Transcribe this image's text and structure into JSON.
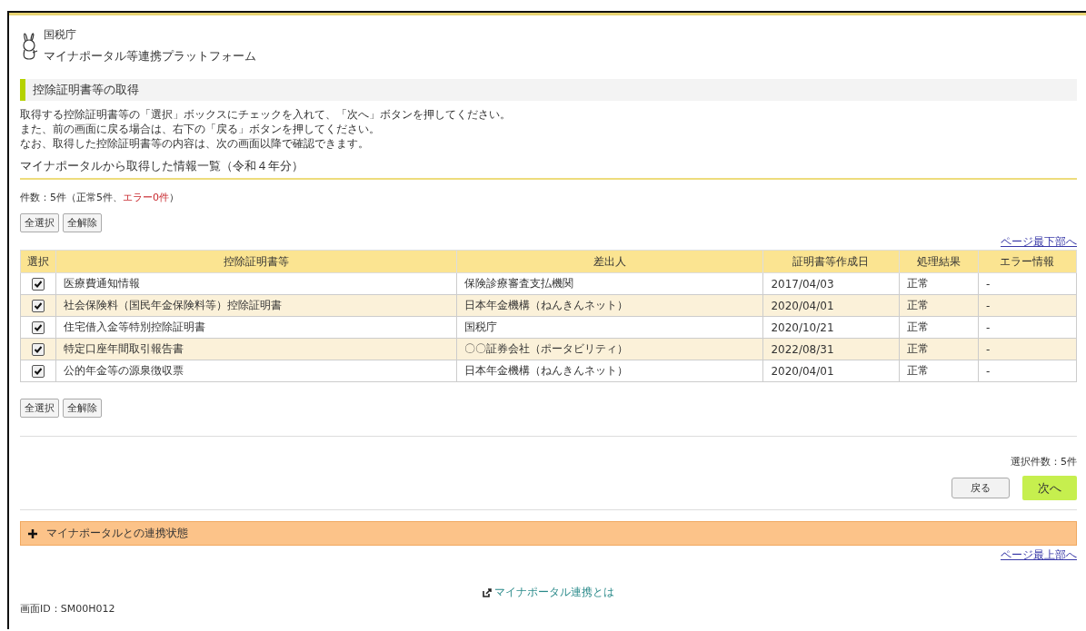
{
  "header": {
    "agency": "国税庁",
    "platform": "マイナポータル等連携プラットフォーム"
  },
  "page_title": "控除証明書等の取得",
  "instructions": [
    "取得する控除証明書等の「選択」ボックスにチェックを入れて、「次へ」ボタンを押してください。",
    "また、前の画面に戻る場合は、右下の「戻る」ボタンを押してください。",
    "なお、取得した控除証明書等の内容は、次の画面以降で確認できます。"
  ],
  "section_title": "マイナポータルから取得した情報一覧（令和４年分）",
  "count": {
    "text": "件数：5件（正常5件、",
    "error": "エラー0件",
    "close": "）"
  },
  "bulk_buttons_top": [
    "全選択",
    "全解除"
  ],
  "to_bottom_link": "ページ最下部へ",
  "table": {
    "columns": [
      "選択",
      "控除証明書等",
      "差出人",
      "証明書等作成日",
      "処理結果",
      "エラー情報"
    ],
    "rows": [
      {
        "checked": true,
        "document": "医療費通知情報",
        "sender": "保険診療審査支払機関",
        "date": "2017/04/03",
        "result": "正常",
        "error": "-"
      },
      {
        "checked": true,
        "document": "社会保険料（国民年金保険料等）控除証明書",
        "sender": "日本年金機構（ねんきんネット）",
        "date": "2020/04/01",
        "result": "正常",
        "error": "-"
      },
      {
        "checked": true,
        "document": "住宅借入金等特別控除証明書",
        "sender": "国税庁",
        "date": "2020/10/21",
        "result": "正常",
        "error": "-"
      },
      {
        "checked": true,
        "document": "特定口座年間取引報告書",
        "sender": "〇〇証券会社（ポータビリティ）",
        "date": "2022/08/31",
        "result": "正常",
        "error": "-"
      },
      {
        "checked": true,
        "document": "公的年金等の源泉徴収票",
        "sender": "日本年金機構（ねんきんネット）",
        "date": "2020/04/01",
        "result": "正常",
        "error": "-"
      }
    ]
  },
  "bulk_buttons_bottom": [
    "全選択",
    "全解除"
  ],
  "selected_count": "選択件数：5件",
  "back_button": "戻る",
  "next_button": "次へ",
  "accordion": {
    "label": "マイナポータルとの連携状態",
    "expanded": false
  },
  "to_top_link": "ページ最上部へ",
  "about_link": "マイナポータル連携とは",
  "screen_id": "画面ID：SM00H012"
}
